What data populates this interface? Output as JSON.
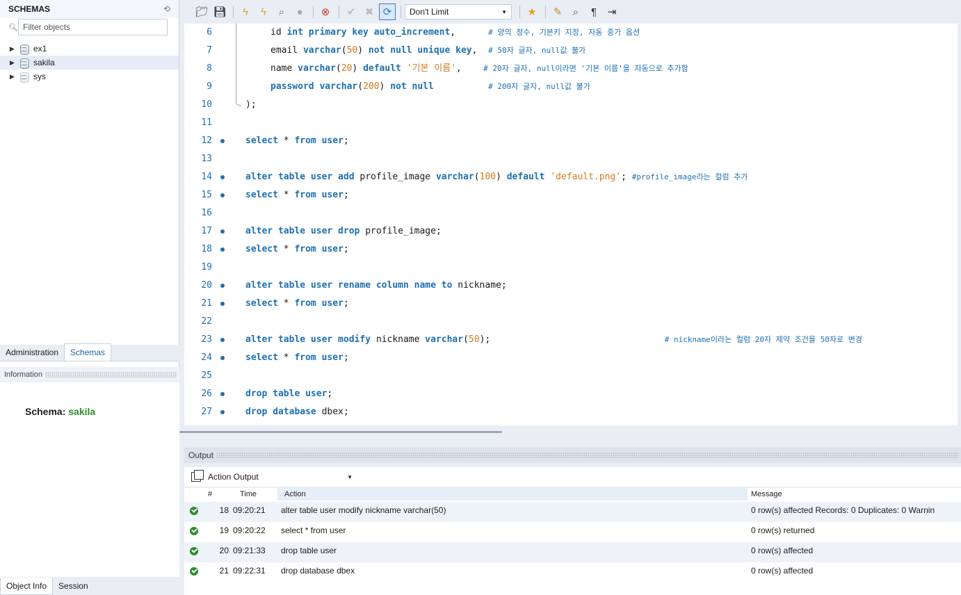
{
  "sidebar": {
    "title": "SCHEMAS",
    "filter_placeholder": "Filter objects",
    "schemas": [
      {
        "name": "ex1",
        "selected": false
      },
      {
        "name": "sakila",
        "selected": true
      },
      {
        "name": "sys",
        "selected": false
      }
    ],
    "tabs": [
      "Administration",
      "Schemas"
    ],
    "active_tab": "Schemas",
    "info_header": "Information",
    "schema_label": "Schema:",
    "schema_value": "sakila",
    "bottom_tabs": [
      "Object Info",
      "Session"
    ]
  },
  "toolbar": {
    "limit": "Don't Limit",
    "icons": [
      "open-folder-icon",
      "save-icon",
      "execute-icon",
      "execute-statement-icon",
      "explain-icon",
      "stop-icon",
      "error-toggle-icon",
      "commit-icon",
      "rollback-icon",
      "autocommit-icon",
      "bookmark-icon",
      "beautify-icon",
      "find-icon",
      "invisible-chars-icon",
      "wrap-icon"
    ]
  },
  "editor": {
    "lines": [
      {
        "n": "6",
        "dot": false,
        "indent": true,
        "parts": [
          [
            "",
            "id "
          ],
          [
            "kw",
            "int primary key auto_increment"
          ],
          [
            "",
            ",      "
          ],
          [
            "cmt",
            "# 양의 정수, 기본키 지정, 자동 증가 옵션"
          ]
        ]
      },
      {
        "n": "7",
        "dot": false,
        "indent": true,
        "parts": [
          [
            "",
            "email "
          ],
          [
            "kw",
            "varchar"
          ],
          [
            "",
            "("
          ],
          [
            "num",
            "50"
          ],
          [
            "",
            ") "
          ],
          [
            "kw",
            "not null unique key"
          ],
          [
            "",
            ",  "
          ],
          [
            "cmt",
            "# 50자 글자, null값 불가"
          ]
        ]
      },
      {
        "n": "8",
        "dot": false,
        "indent": true,
        "parts": [
          [
            "",
            "name "
          ],
          [
            "kw",
            "varchar"
          ],
          [
            "",
            "("
          ],
          [
            "num",
            "20"
          ],
          [
            "",
            ") "
          ],
          [
            "kw",
            "default"
          ],
          [
            "str",
            " '기본 이름'"
          ],
          [
            "",
            ",    "
          ],
          [
            "cmt",
            "# 20자 글자, null이라면 '기본 이름'을 자동으로 추가함"
          ]
        ]
      },
      {
        "n": "9",
        "dot": false,
        "indent": true,
        "parts": [
          [
            "kw",
            "password varchar"
          ],
          [
            "",
            "("
          ],
          [
            "num",
            "200"
          ],
          [
            "",
            ") "
          ],
          [
            "kw",
            "not null"
          ],
          [
            "",
            "          "
          ],
          [
            "cmt",
            "# 200자 글자, null값 불가"
          ]
        ]
      },
      {
        "n": "10",
        "dot": false,
        "indent": false,
        "parts": [
          [
            "",
            ");"
          ]
        ]
      },
      {
        "n": "11",
        "dot": false,
        "indent": false,
        "parts": []
      },
      {
        "n": "12",
        "dot": true,
        "indent": false,
        "parts": [
          [
            "kw",
            "select"
          ],
          [
            "",
            " * "
          ],
          [
            "kw",
            "from user"
          ],
          [
            "",
            ";"
          ]
        ]
      },
      {
        "n": "13",
        "dot": false,
        "indent": false,
        "parts": []
      },
      {
        "n": "14",
        "dot": true,
        "indent": false,
        "parts": [
          [
            "kw",
            "alter table user add"
          ],
          [
            "",
            " profile_image "
          ],
          [
            "kw",
            "varchar"
          ],
          [
            "",
            "("
          ],
          [
            "num",
            "100"
          ],
          [
            "",
            ") "
          ],
          [
            "kw",
            "default"
          ],
          [
            "str",
            " 'default.png'"
          ],
          [
            "",
            "; "
          ],
          [
            "cmt",
            "#profile_image라는 컬럼 추가"
          ]
        ]
      },
      {
        "n": "15",
        "dot": true,
        "indent": false,
        "parts": [
          [
            "kw",
            "select"
          ],
          [
            "",
            " * "
          ],
          [
            "kw",
            "from user"
          ],
          [
            "",
            ";"
          ]
        ]
      },
      {
        "n": "16",
        "dot": false,
        "indent": false,
        "parts": []
      },
      {
        "n": "17",
        "dot": true,
        "indent": false,
        "parts": [
          [
            "kw",
            "alter table user drop"
          ],
          [
            "",
            " profile_image;"
          ]
        ]
      },
      {
        "n": "18",
        "dot": true,
        "indent": false,
        "parts": [
          [
            "kw",
            "select"
          ],
          [
            "",
            " * "
          ],
          [
            "kw",
            "from user"
          ],
          [
            "",
            ";"
          ]
        ]
      },
      {
        "n": "19",
        "dot": false,
        "indent": false,
        "parts": []
      },
      {
        "n": "20",
        "dot": true,
        "indent": false,
        "parts": [
          [
            "kw",
            "alter table user rename column name to"
          ],
          [
            "",
            " nickname;"
          ]
        ]
      },
      {
        "n": "21",
        "dot": true,
        "indent": false,
        "parts": [
          [
            "kw",
            "select"
          ],
          [
            "",
            " * "
          ],
          [
            "kw",
            "from user"
          ],
          [
            "",
            ";"
          ]
        ]
      },
      {
        "n": "22",
        "dot": false,
        "indent": false,
        "parts": []
      },
      {
        "n": "23",
        "dot": true,
        "indent": false,
        "parts": [
          [
            "kw",
            "alter table user modify"
          ],
          [
            "",
            " nickname "
          ],
          [
            "kw",
            "varchar"
          ],
          [
            "",
            "("
          ],
          [
            "num",
            "50"
          ],
          [
            "",
            ");                                "
          ],
          [
            "cmt",
            "# nickname이라는 컬럼 20자 제약 조건을 50자로 변경"
          ]
        ]
      },
      {
        "n": "24",
        "dot": true,
        "indent": false,
        "parts": [
          [
            "kw",
            "select"
          ],
          [
            "",
            " * "
          ],
          [
            "kw",
            "from user"
          ],
          [
            "",
            ";"
          ]
        ]
      },
      {
        "n": "25",
        "dot": false,
        "indent": false,
        "parts": []
      },
      {
        "n": "26",
        "dot": true,
        "indent": false,
        "parts": [
          [
            "kw",
            "drop table user"
          ],
          [
            "",
            ";"
          ]
        ]
      },
      {
        "n": "27",
        "dot": true,
        "indent": false,
        "parts": [
          [
            "kw",
            "drop database"
          ],
          [
            "",
            " dbex;"
          ]
        ]
      }
    ]
  },
  "output": {
    "header": "Output",
    "mode": "Action Output",
    "columns": {
      "num": "#",
      "time": "Time",
      "action": "Action",
      "message": "Message"
    },
    "rows": [
      {
        "num": "18",
        "time": "09:20:21",
        "action": "alter table user modify nickname varchar(50)",
        "message": "0 row(s) affected Records: 0  Duplicates: 0  Warnin",
        "status": "success"
      },
      {
        "num": "19",
        "time": "09:20:22",
        "action": "select * from user",
        "message": "0 row(s) returned",
        "status": "success"
      },
      {
        "num": "20",
        "time": "09:21:33",
        "action": "drop table user",
        "message": "0 row(s) affected",
        "status": "success"
      },
      {
        "num": "21",
        "time": "09:22:31",
        "action": "drop database dbex",
        "message": "0 row(s) affected",
        "status": "success"
      }
    ]
  },
  "colors": {
    "keyword": "#1d6fb0",
    "string": "#d07a1d",
    "success": "#2e8b2e",
    "schema_value": "#2e8b2e"
  }
}
